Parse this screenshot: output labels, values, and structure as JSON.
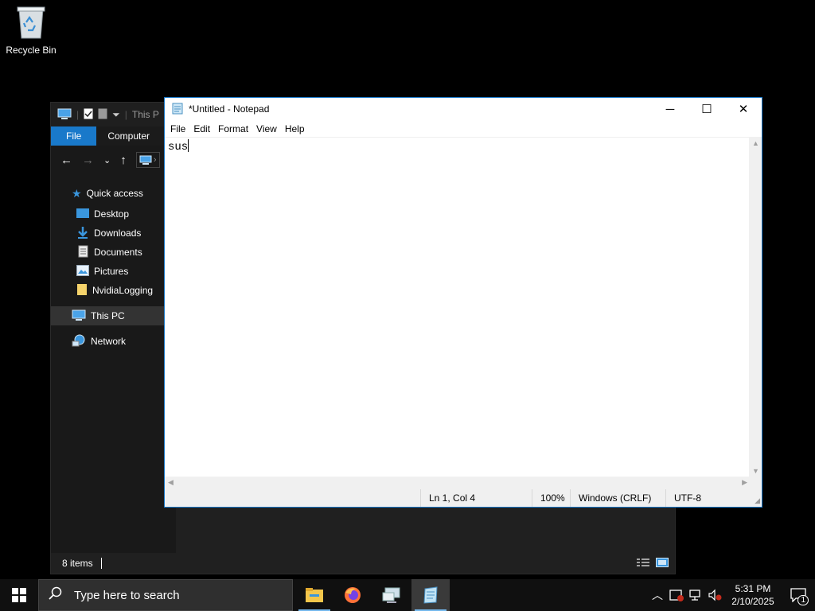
{
  "desktop": {
    "icons": [
      {
        "label": "Recycle Bin",
        "icon": "recycle-bin-icon"
      }
    ]
  },
  "explorer": {
    "title": "This P",
    "ribbon_tabs": [
      "File",
      "Computer"
    ],
    "nav": {
      "back": "←",
      "forward": "→",
      "recent": "⌄",
      "up": "↑",
      "chevron": "›"
    },
    "sidebar": {
      "quick_access": "Quick access",
      "quick_items": [
        "Desktop",
        "Downloads",
        "Documents",
        "Pictures",
        "NvidiaLogging"
      ],
      "this_pc": "This PC",
      "network": "Network"
    },
    "status": {
      "items": "8 items"
    }
  },
  "notepad": {
    "title": "*Untitled - Notepad",
    "controls": {
      "minimize": "─",
      "maximize": "☐",
      "close": "✕"
    },
    "menu": [
      "File",
      "Edit",
      "Format",
      "View",
      "Help"
    ],
    "content": "sus",
    "status": {
      "position": "Ln 1, Col 4",
      "zoom": "100%",
      "line_ending": "Windows (CRLF)",
      "encoding": "UTF-8"
    }
  },
  "taskbar": {
    "search_placeholder": "Type here to search",
    "apps": [
      "file-explorer-icon",
      "firefox-icon",
      "network-app-icon",
      "notepad-icon"
    ],
    "time": "5:31 PM",
    "date": "2/10/2025",
    "notification_count": "1"
  }
}
